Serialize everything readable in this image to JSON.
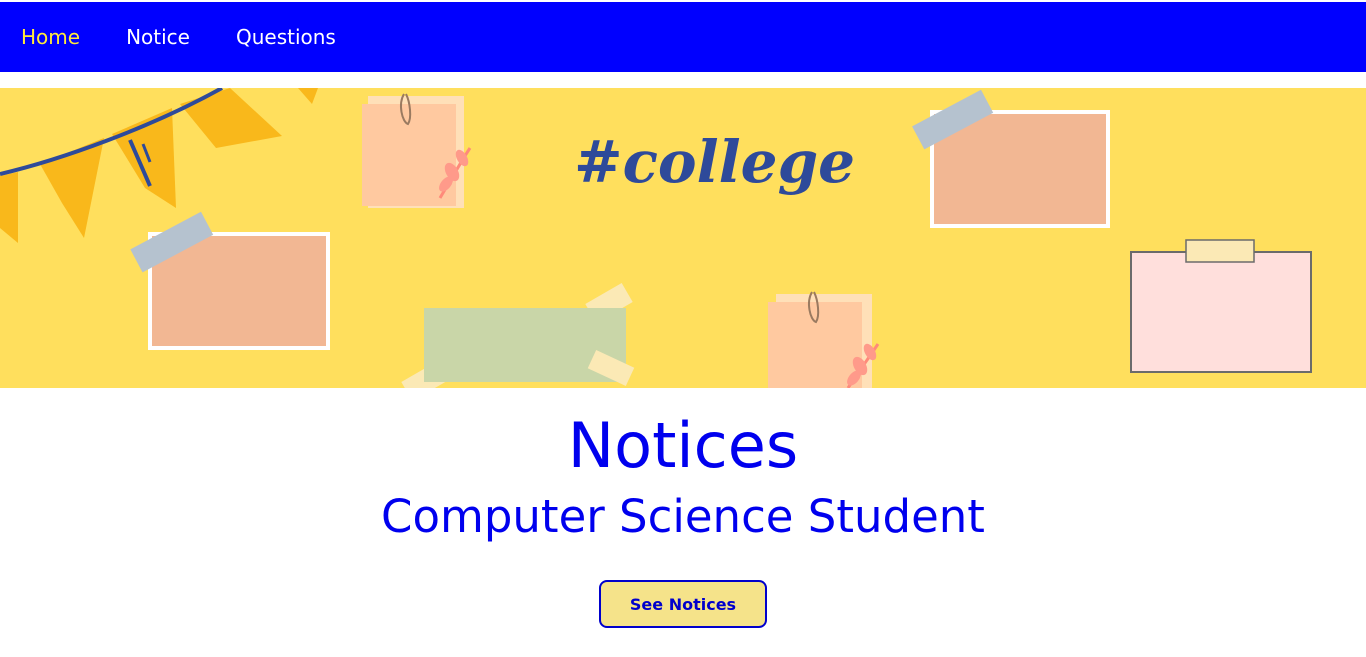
{
  "nav": {
    "items": [
      {
        "label": "Home",
        "active": true
      },
      {
        "label": "Notice",
        "active": false
      },
      {
        "label": "Questions",
        "active": false
      }
    ],
    "background_color": "#0000ff",
    "active_color": "#ffeb3b"
  },
  "banner": {
    "hashtag_text": "#college",
    "background_color": "#ffdf5d"
  },
  "main": {
    "title": "Notices",
    "subtitle": "Computer Science Student",
    "cta_label": "See Notices",
    "text_color": "#0000ee"
  }
}
